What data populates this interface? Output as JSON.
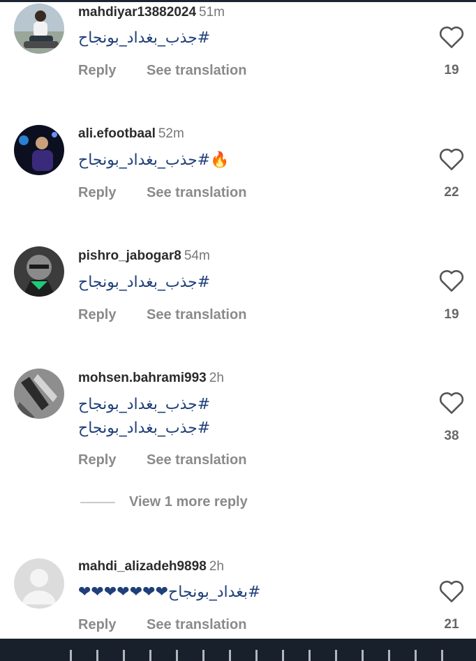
{
  "actions": {
    "reply": "Reply",
    "see_translation": "See translation"
  },
  "comments": [
    {
      "username": "mahdiyar13882024",
      "time": "51m",
      "lines": [
        "#جذب_بغداد_بونجاح"
      ],
      "likes": "19"
    },
    {
      "username": "ali.efootbaal",
      "time": "52m",
      "lines": [
        "🔥#جذب_بغداد_بونجاح"
      ],
      "likes": "22"
    },
    {
      "username": "pishro_jabogar8",
      "time": "54m",
      "lines": [
        "#جذب_بغداد_بونجاح"
      ],
      "likes": "19"
    },
    {
      "username": "mohsen.bahrami993",
      "time": "2h",
      "lines": [
        "#جذب_بغداد_بونجاح",
        "#جذب_بغداد_بونجاح"
      ],
      "likes": "38"
    },
    {
      "username": "mahdi_alizadeh9898",
      "time": "2h",
      "lines": [
        "#بغداد_بونجاح❤❤❤❤❤❤❤"
      ],
      "likes": "21"
    }
  ],
  "view_more": "View 1 more reply",
  "colors": {
    "hashtag": "#1f3f7a",
    "muted": "#8a8a8a",
    "bottom_bar": "#18202b"
  }
}
